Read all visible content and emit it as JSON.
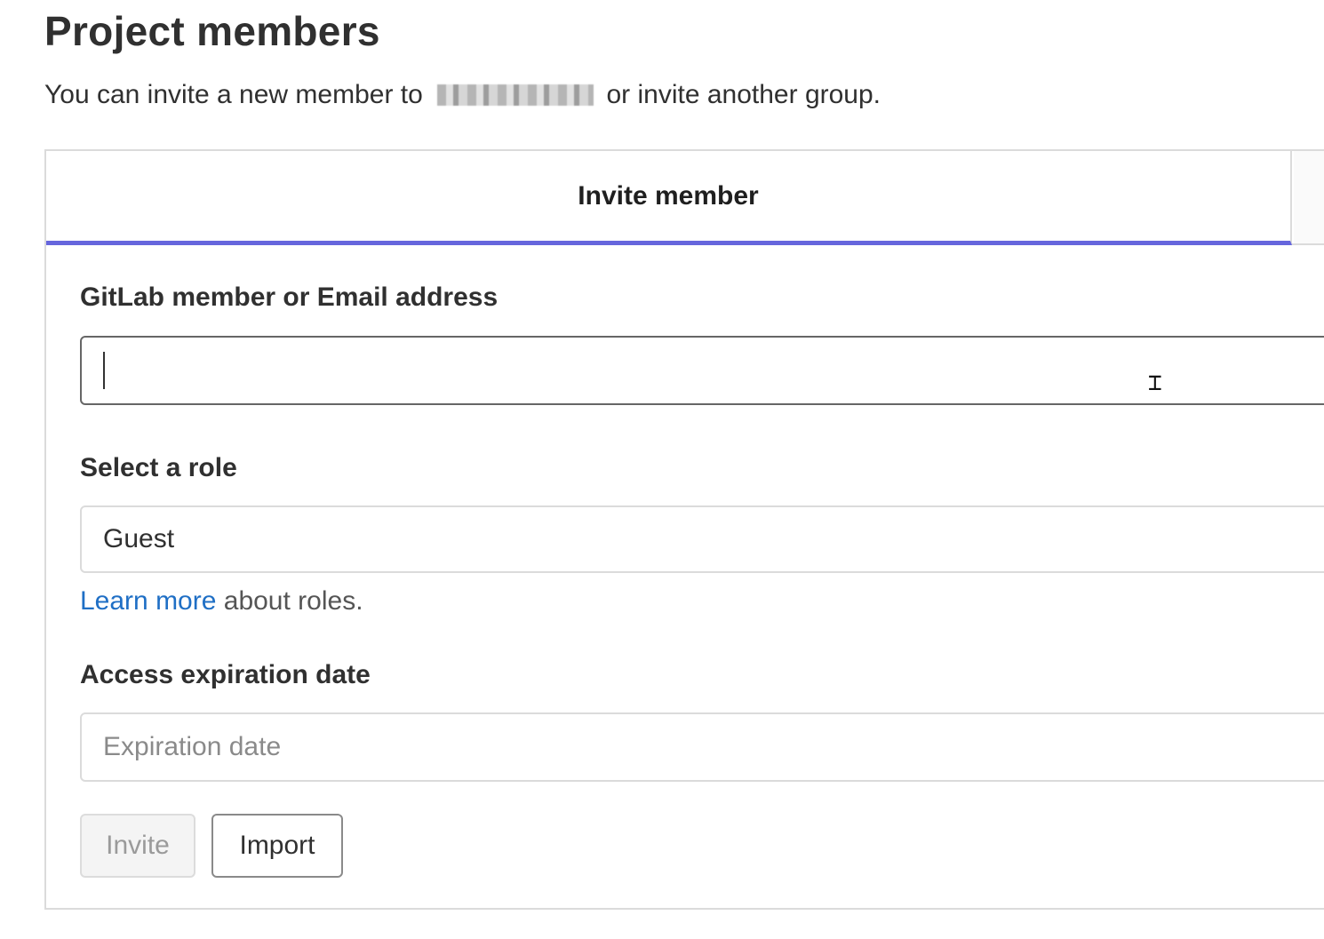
{
  "page": {
    "title": "Project members",
    "intro_before": "You can invite a new member to ",
    "intro_after": " or invite another group."
  },
  "tabs": [
    {
      "label": "Invite member",
      "active": true
    }
  ],
  "form": {
    "member_label": "GitLab member or Email address",
    "member_value": "",
    "role_label": "Select a role",
    "role_value": "Guest",
    "help_link": "Learn more",
    "help_rest": " about roles.",
    "expiration_label": "Access expiration date",
    "expiration_placeholder": "Expiration date",
    "invite_button": "Invite",
    "import_button": "Import"
  },
  "colors": {
    "tab_accent": "#6666dd",
    "link": "#1f6fc5",
    "text": "#303030"
  },
  "icons": {
    "cursor": "i-beam-cursor-icon"
  }
}
